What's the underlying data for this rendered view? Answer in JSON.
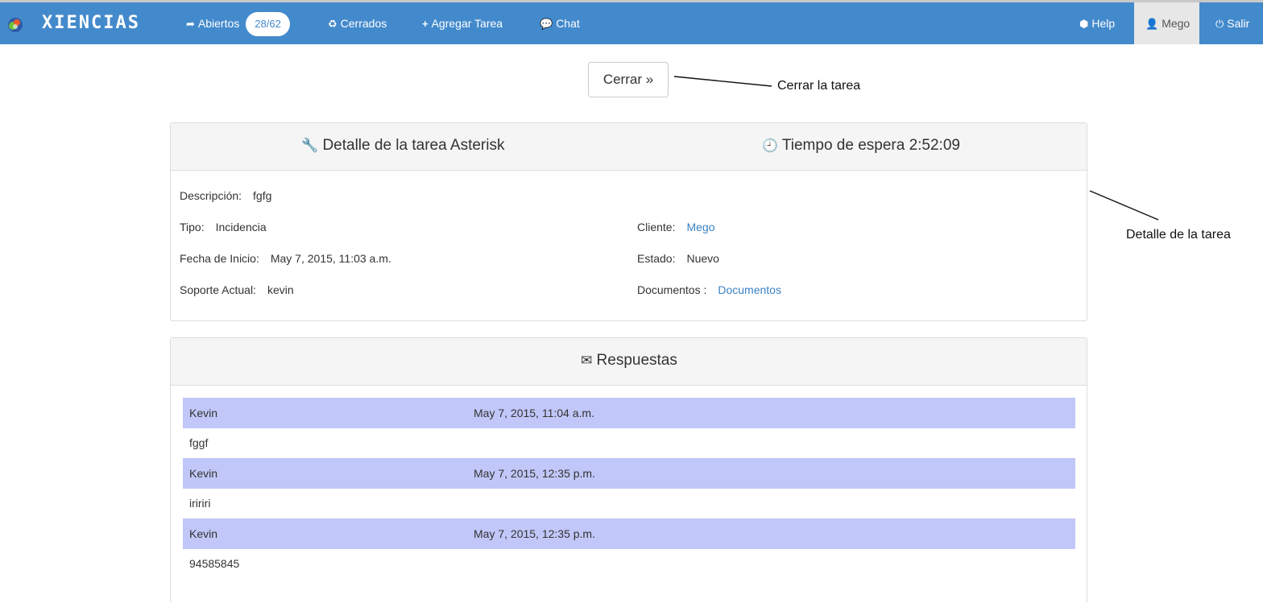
{
  "navbar": {
    "brand": "XIENCIAS",
    "abiertos_label": "Abiertos",
    "abiertos_count": "28/62",
    "cerrados_label": "Cerrados",
    "agregar_label": "Agregar Tarea",
    "chat_label": "Chat",
    "help_label": "Help",
    "user_label": "Mego",
    "salir_label": "Salir"
  },
  "actions": {
    "cerrar_label": "Cerrar »"
  },
  "annotations": {
    "cerrar_note": "Cerrar la tarea",
    "detalle_note": "Detalle de la tarea"
  },
  "detail": {
    "title": "Detalle de la tarea Asterisk",
    "wait_time": "Tiempo de espera 2:52:09",
    "descripcion_label": "Descripción:",
    "descripcion_value": "fgfg",
    "tipo_label": "Tipo:",
    "tipo_value": "Incidencia",
    "fecha_label": "Fecha de Inicio:",
    "fecha_value": "May 7, 2015, 11:03 a.m.",
    "soporte_label": "Soporte Actual:",
    "soporte_value": "kevin",
    "cliente_label": "Cliente:",
    "cliente_value": "Mego",
    "estado_label": "Estado:",
    "estado_value": "Nuevo",
    "documentos_label": "Documentos :",
    "documentos_value": "Documentos"
  },
  "responses": {
    "title": "Respuestas",
    "items": [
      {
        "author": "Kevin",
        "date": "May 7, 2015, 11:04 a.m.",
        "body": "fggf"
      },
      {
        "author": "Kevin",
        "date": "May 7, 2015, 12:35 p.m.",
        "body": "iririri"
      },
      {
        "author": "Kevin",
        "date": "May 7, 2015, 12:35 p.m.",
        "body": "94585845"
      }
    ]
  },
  "colors": {
    "navbar": "#438acc",
    "response_row": "#c1c7f8",
    "link": "#3a82c4"
  }
}
